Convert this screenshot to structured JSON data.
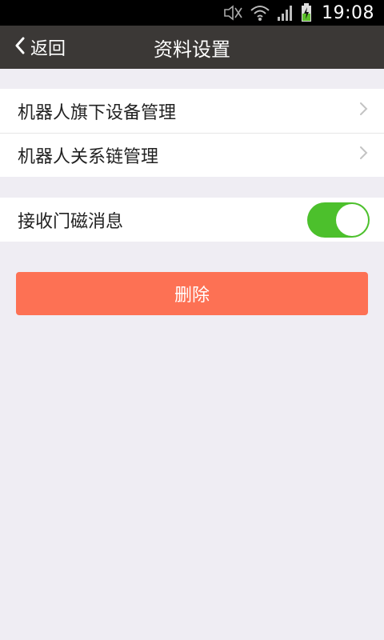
{
  "status_bar": {
    "time": "19:08",
    "icons": [
      "mute-icon",
      "wifi-icon",
      "signal-icon",
      "battery-charging-icon"
    ]
  },
  "nav": {
    "back_label": "返回",
    "title": "资料设置"
  },
  "settings_group_1": {
    "items": [
      {
        "label": "机器人旗下设备管理"
      },
      {
        "label": "机器人关系链管理"
      }
    ]
  },
  "settings_group_2": {
    "items": [
      {
        "label": "接收门磁消息",
        "toggle_on": true
      }
    ]
  },
  "actions": {
    "delete_label": "删除"
  },
  "colors": {
    "nav_bg": "#3b3836",
    "toggle_on": "#4cc02c",
    "delete_bg": "#fd7154",
    "page_bg": "#efedf3"
  }
}
